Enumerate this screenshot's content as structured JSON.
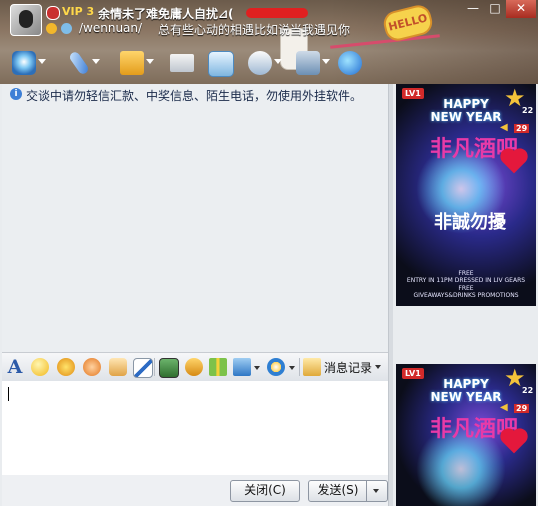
{
  "window": {
    "title_buttons": [
      "—",
      "□",
      "✕"
    ]
  },
  "profile": {
    "vip": "VIP 3",
    "nickname": "余情未了难免庸人自扰⊿(",
    "account": "/wennuan/",
    "signature": "总有些心动的相遇比如说当我遇见你"
  },
  "header_art": {
    "sticker_text": "HELLO"
  },
  "toolbar": {
    "items": [
      {
        "icon": "video-call-icon"
      },
      {
        "icon": "voice-call-icon"
      },
      {
        "icon": "send-file-icon"
      },
      {
        "icon": "email-icon"
      },
      {
        "icon": "create-group-icon"
      },
      {
        "icon": "remote-assist-icon"
      },
      {
        "icon": "app-settings-icon"
      },
      {
        "icon": "share-screen-icon"
      }
    ]
  },
  "chat": {
    "notice": "交谈中请勿轻信汇款、中奖信息、陌生电话，勿使用外挂软件。"
  },
  "format_bar": {
    "font_button": "A",
    "history_label": "消息记录"
  },
  "buttons": {
    "close": "关闭(C)",
    "send": "发送(S)"
  },
  "ads": [
    {
      "level": "LV1",
      "star_num": "22",
      "rank_num": "29",
      "headline_1": "HAPPY",
      "headline_2": "NEW YEAR",
      "art_title": "非凡酒吧",
      "art_slogan": "非誠勿擾",
      "fine_print_1": "FREE",
      "fine_print_2": "ENTRY IN 11PM DRESSED IN LIV GEARS",
      "fine_print_3": "FREE",
      "fine_print_4": "GIVEAWAYS&DRINKS PROMOTIONS"
    },
    {
      "level": "LV1",
      "star_num": "22",
      "rank_num": "29",
      "headline_1": "HAPPY",
      "headline_2": "NEW YEAR",
      "art_title": "非凡酒吧"
    }
  ]
}
